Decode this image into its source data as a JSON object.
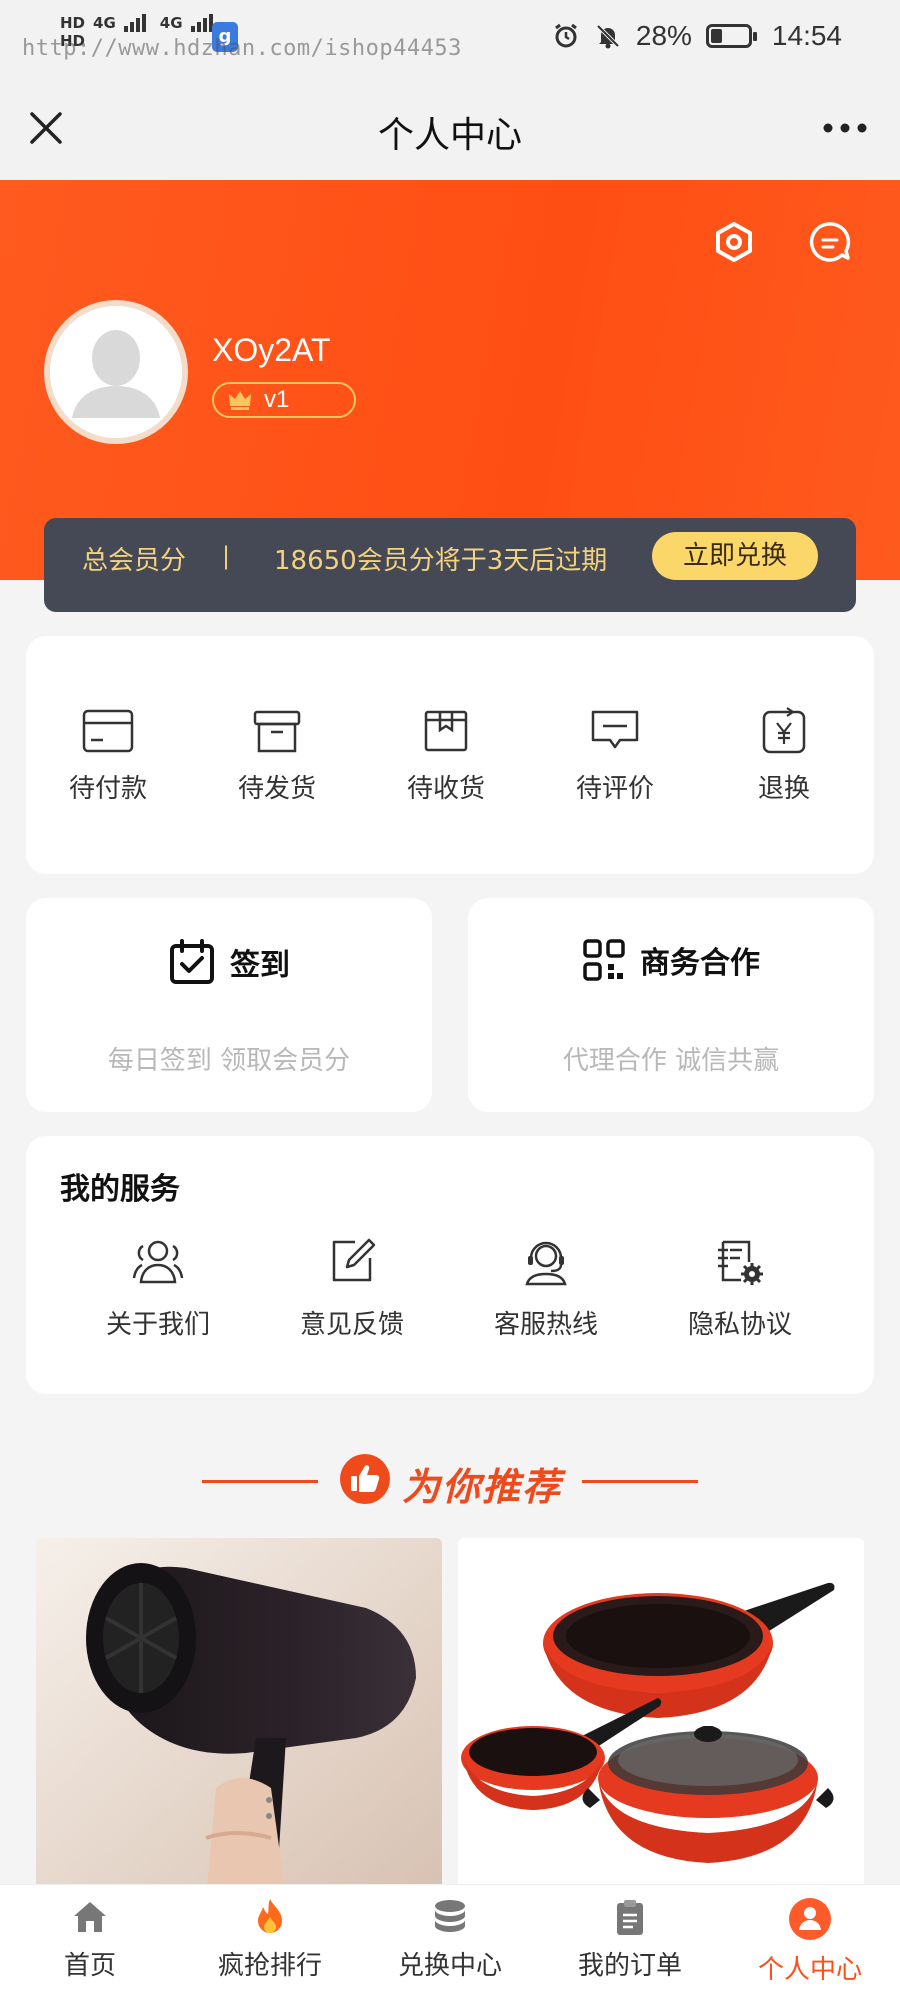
{
  "status_bar": {
    "hd_labels": [
      "HD",
      "HD"
    ],
    "network_labels": [
      "4G",
      "4G"
    ],
    "app_badge": "g",
    "watermark": "http://www.hdzhan.com/ishop44453",
    "battery_percent": "28%",
    "battery_level": 0.28,
    "time": "14:54"
  },
  "nav": {
    "title": "个人中心"
  },
  "profile": {
    "username": "XOy2AT",
    "level": "v1"
  },
  "points": {
    "label": "总会员分",
    "separator": "|",
    "expire_text": "18650会员分将于3天后过期",
    "redeem_button": "立即兑换"
  },
  "orders": [
    {
      "label": "待付款",
      "icon": "wallet-icon"
    },
    {
      "label": "待发货",
      "icon": "box-icon"
    },
    {
      "label": "待收货",
      "icon": "package-icon"
    },
    {
      "label": "待评价",
      "icon": "comment-icon"
    },
    {
      "label": "退换",
      "icon": "refund-icon"
    }
  ],
  "checkin": {
    "title": "签到",
    "subtitle": "每日签到 领取会员分"
  },
  "business": {
    "title": "商务合作",
    "subtitle": "代理合作 诚信共赢"
  },
  "services": {
    "title": "我的服务",
    "items": [
      {
        "label": "关于我们",
        "icon": "users-icon"
      },
      {
        "label": "意见反馈",
        "icon": "edit-icon"
      },
      {
        "label": "客服热线",
        "icon": "headset-icon"
      },
      {
        "label": "隐私协议",
        "icon": "document-settings-icon"
      }
    ]
  },
  "recommend": {
    "title": "为你推荐"
  },
  "tabs": [
    {
      "label": "首页",
      "icon": "home-icon"
    },
    {
      "label": "疯抢排行",
      "icon": "fire-icon"
    },
    {
      "label": "兑换中心",
      "icon": "coins-icon"
    },
    {
      "label": "我的订单",
      "icon": "clipboard-icon"
    },
    {
      "label": "个人中心",
      "icon": "user-icon",
      "active": true
    }
  ],
  "colors": {
    "brand": "#ff5a1f",
    "points_bar": "#454855",
    "gold": "#f3d27e",
    "active_tab": "#ff4f19"
  }
}
